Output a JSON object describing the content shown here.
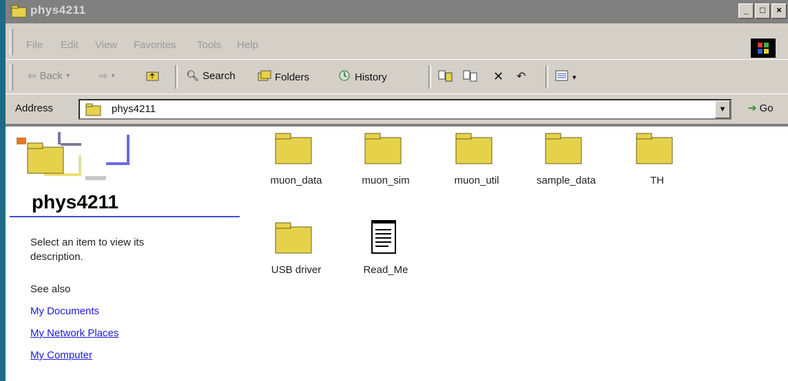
{
  "window": {
    "title": "phys4211",
    "buttons": {
      "minimize": "_",
      "maximize": "□",
      "close": "×"
    }
  },
  "menu": {
    "items": [
      "File",
      "Edit",
      "View",
      "Favorites",
      "Tools",
      "Help"
    ]
  },
  "toolbar": {
    "back_label": "Back",
    "search_label": "Search",
    "folders_label": "Folders",
    "history_label": "History",
    "views_label": "▾"
  },
  "address": {
    "label": "Address",
    "value": "phys4211",
    "go_label": "Go"
  },
  "panel": {
    "title": "phys4211",
    "description": "Select an item to view its description.",
    "see_also": "See also",
    "links": [
      "My Documents",
      "My Network Places",
      "My Computer"
    ]
  },
  "files": [
    {
      "name": "muon_data",
      "type": "folder"
    },
    {
      "name": "muon_sim",
      "type": "folder"
    },
    {
      "name": "muon_util",
      "type": "folder"
    },
    {
      "name": "sample_data",
      "type": "folder"
    },
    {
      "name": "TH",
      "type": "folder"
    },
    {
      "name": "USB driver",
      "type": "folder"
    },
    {
      "name": "Read_Me",
      "type": "text-document"
    }
  ]
}
